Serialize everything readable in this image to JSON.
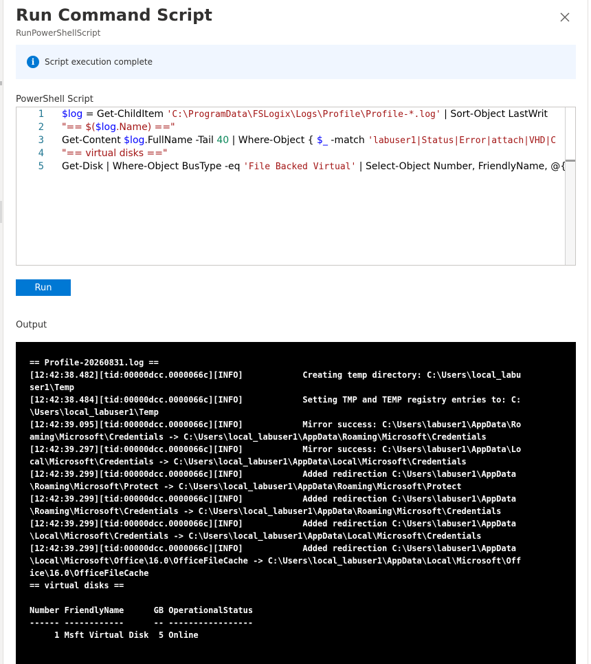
{
  "dialog": {
    "title": "Run Command Script",
    "subtitle": "RunPowerShellScript",
    "close_icon": "close-icon"
  },
  "info": {
    "icon": "info-icon",
    "icon_glyph": "i",
    "message": "Script execution complete",
    "accent": "#0078d4",
    "background": "#f0f6ff"
  },
  "script": {
    "label": "PowerShell Script",
    "line_numbers": [
      "1",
      "2",
      "3",
      "4",
      "5"
    ],
    "lines": [
      [
        {
          "t": "$log",
          "c": "var"
        },
        {
          "t": " = Get-ChildItem ",
          "c": "kw"
        },
        {
          "t": "'C:\\ProgramData\\FSLogix\\Logs\\Profile\\Profile-*.log'",
          "c": "str"
        },
        {
          "t": " | Sort-Object LastWrit",
          "c": "kw"
        }
      ],
      [
        {
          "t": "\"== $(",
          "c": "strp"
        },
        {
          "t": "$log",
          "c": "var"
        },
        {
          "t": ".Name) ==\"",
          "c": "strp"
        }
      ],
      [
        {
          "t": "Get-Content ",
          "c": "kw"
        },
        {
          "t": "$log",
          "c": "var"
        },
        {
          "t": ".FullName -Tail ",
          "c": "kw"
        },
        {
          "t": "40",
          "c": "num"
        },
        {
          "t": " | Where-Object { ",
          "c": "kw"
        },
        {
          "t": "$_",
          "c": "var"
        },
        {
          "t": " -match ",
          "c": "kw"
        },
        {
          "t": "'labuser1|Status|Error|attach|VHD|C",
          "c": "str"
        }
      ],
      [
        {
          "t": "\"== virtual disks ==\"",
          "c": "strp"
        }
      ],
      [
        {
          "t": "Get-Disk | Where-Object BusType -eq ",
          "c": "kw"
        },
        {
          "t": "'File Backed Virtual'",
          "c": "str"
        },
        {
          "t": " | Select-Object Number, FriendlyName, @{n",
          "c": "kw"
        }
      ]
    ]
  },
  "run_button": {
    "label": "Run",
    "color": "#0078d4"
  },
  "output": {
    "label": "Output",
    "lines": [
      "== Profile-20260831.log ==",
      "[12:42:38.482][tid:00000dcc.0000066c][INFO]            Creating temp directory: C:\\Users\\local_labu",
      "ser1\\Temp",
      "[12:42:38.484][tid:00000dcc.0000066c][INFO]            Setting TMP and TEMP registry entries to: C:",
      "\\Users\\local_labuser1\\Temp",
      "[12:42:39.095][tid:00000dcc.0000066c][INFO]            Mirror success: C:\\Users\\labuser1\\AppData\\Ro",
      "aming\\Microsoft\\Credentials -> C:\\Users\\local_labuser1\\AppData\\Roaming\\Microsoft\\Credentials",
      "[12:42:39.297][tid:00000dcc.0000066c][INFO]            Mirror success: C:\\Users\\labuser1\\AppData\\Lo",
      "cal\\Microsoft\\Credentials -> C:\\Users\\local_labuser1\\AppData\\Local\\Microsoft\\Credentials",
      "[12:42:39.299][tid:00000dcc.0000066c][INFO]            Added redirection C:\\Users\\labuser1\\AppData",
      "\\Roaming\\Microsoft\\Protect -> C:\\Users\\local_labuser1\\AppData\\Roaming\\Microsoft\\Protect",
      "[12:42:39.299][tid:00000dcc.0000066c][INFO]            Added redirection C:\\Users\\labuser1\\AppData",
      "\\Roaming\\Microsoft\\Credentials -> C:\\Users\\local_labuser1\\AppData\\Roaming\\Microsoft\\Credentials",
      "[12:42:39.299][tid:00000dcc.0000066c][INFO]            Added redirection C:\\Users\\labuser1\\AppData",
      "\\Local\\Microsoft\\Credentials -> C:\\Users\\local_labuser1\\AppData\\Local\\Microsoft\\Credentials",
      "[12:42:39.299][tid:00000dcc.0000066c][INFO]            Added redirection C:\\Users\\labuser1\\AppData",
      "\\Local\\Microsoft\\Office\\16.0\\OfficeFileCache -> C:\\Users\\local_labuser1\\AppData\\Local\\Microsoft\\Off",
      "ice\\16.0\\OfficeFileCache",
      "== virtual disks ==",
      "",
      "Number FriendlyName      GB OperationalStatus",
      "------ ------------      -- -----------------",
      "     1 Msft Virtual Disk  5 Online"
    ]
  }
}
